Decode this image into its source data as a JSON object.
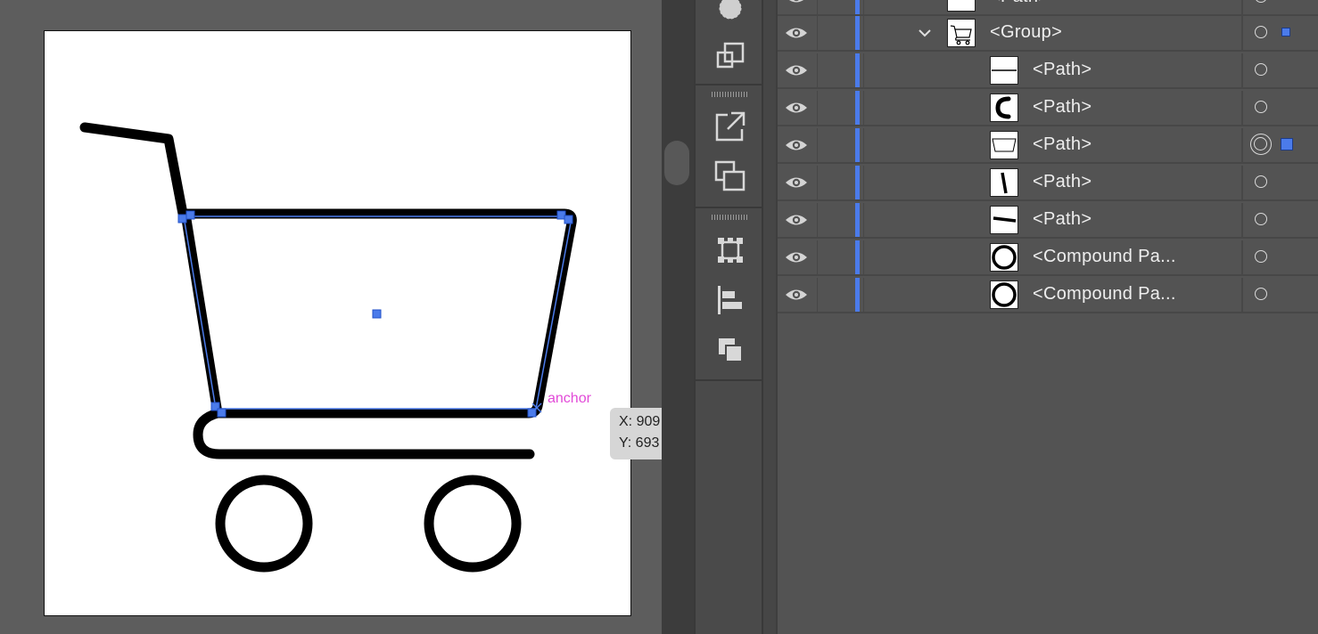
{
  "canvas": {
    "smart_guide_label": "anchor",
    "coordinates": {
      "x": "X: 909",
      "y": "Y: 693"
    },
    "selection_color": "#4b7bea",
    "guide_label_color": "#e24ad8"
  },
  "tools": [
    {
      "icon": "appearance-icon"
    },
    {
      "icon": "arrange-icon"
    },
    {
      "icon": "export-icon"
    },
    {
      "icon": "transform-icon"
    },
    {
      "icon": "artboard-icon"
    },
    {
      "icon": "align-icon"
    },
    {
      "icon": "pathfinder-icon"
    }
  ],
  "layers": {
    "layer_color": "#4b7bea",
    "rows": [
      {
        "name": "<Path>",
        "thumb": "star-thumb",
        "depth": "group"
      },
      {
        "name": "<Group>",
        "thumb": "cart-thumb",
        "depth": "group",
        "expanded": true,
        "selected": true
      },
      {
        "name": "<Path>",
        "thumb": "line-thumb",
        "depth": "child"
      },
      {
        "name": "<Path>",
        "thumb": "arc-thumb",
        "depth": "child"
      },
      {
        "name": "<Path>",
        "thumb": "basket-thumb",
        "depth": "child",
        "targeted": true,
        "selected": true
      },
      {
        "name": "<Path>",
        "thumb": "slash-thumb",
        "depth": "child"
      },
      {
        "name": "<Path>",
        "thumb": "handle-thumb",
        "depth": "child"
      },
      {
        "name": "<Compound Pa...",
        "thumb": "circle-thumb",
        "depth": "child"
      },
      {
        "name": "<Compound Pa...",
        "thumb": "circle-thumb",
        "depth": "child"
      }
    ]
  }
}
